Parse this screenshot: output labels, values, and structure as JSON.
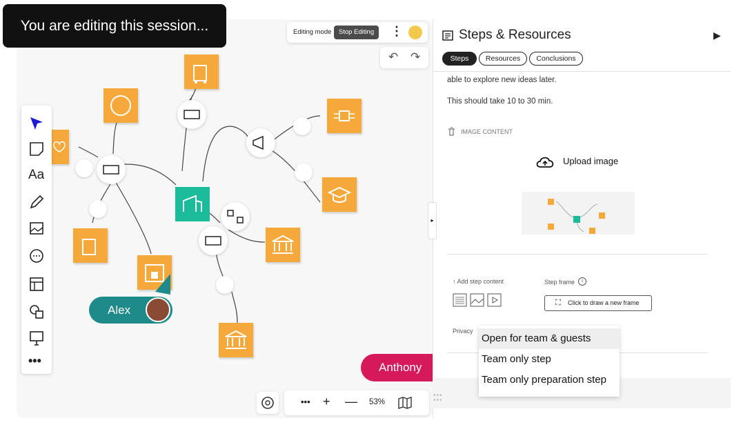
{
  "banner": {
    "text": "You are editing this session..."
  },
  "topbar": {
    "mode_label": "Editing mode",
    "stop_label": "Stop Editing"
  },
  "toolbar": {
    "tools": [
      "select-tool",
      "sticky-note-tool",
      "text-tool",
      "pen-tool",
      "image-tool",
      "comment-tool",
      "layout-tool",
      "shapes-tool",
      "presentation-tool",
      "more-tool"
    ]
  },
  "collaborators": {
    "alex": "Alex",
    "anthony": "Anthony"
  },
  "zoom": {
    "level": "53%"
  },
  "panel": {
    "title": "Steps & Resources",
    "tabs": [
      {
        "label": "Steps"
      },
      {
        "label": "Resources"
      },
      {
        "label": "Conclusions"
      }
    ],
    "description_line": "able to explore new ideas later.",
    "duration": "This should take 10 to 30 min.",
    "image_content_label": "IMAGE CONTENT",
    "upload_label": "Upload image",
    "add_step_content": "↑ Add step content",
    "step_frame_label": "Step frame",
    "draw_frame_label": "Click to draw a new frame",
    "privacy_label": "Privacy",
    "privacy_options": [
      "Open for team & guests",
      "Team only step",
      "Team only preparation step"
    ]
  },
  "colors": {
    "accent_teal": "#1abc9c",
    "node_orange": "#f5a93a",
    "alex_badge": "#1f8a8a",
    "anthony_badge": "#d6195a"
  }
}
